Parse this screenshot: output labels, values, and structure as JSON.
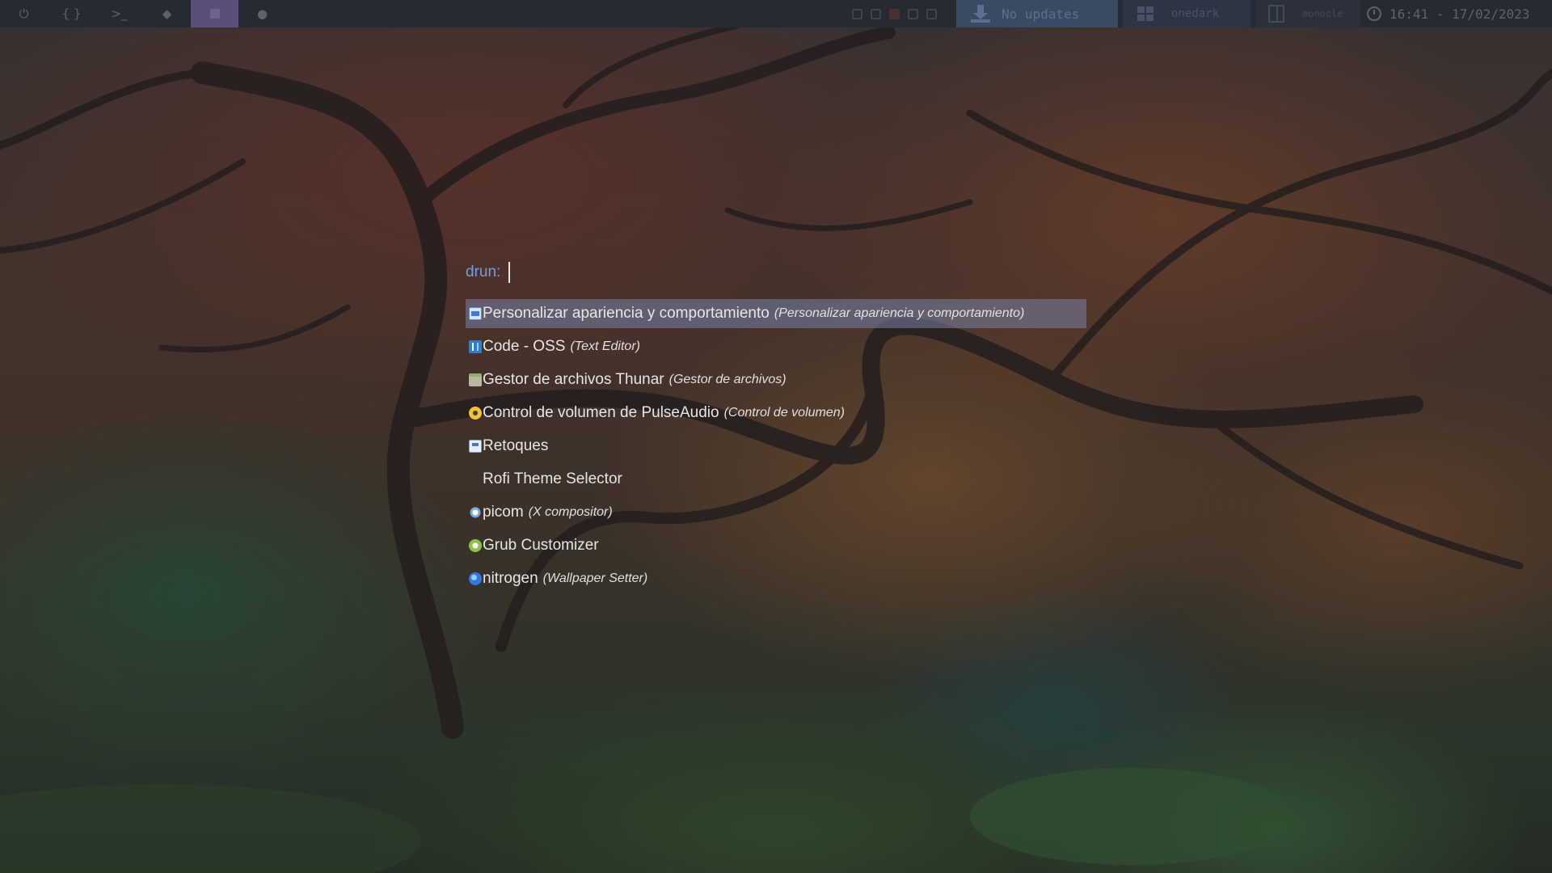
{
  "colors": {
    "bar_bg": "#262a32",
    "active_workspace": "#5a4f78",
    "updates_bg": "#3a4a63",
    "prompt": "#6f9fe0",
    "selection": "#6a7396"
  },
  "topbar": {
    "workspaces": [
      {
        "icon": "power-icon",
        "glyph": "⏻"
      },
      {
        "icon": "braces-icon",
        "glyph": "{}"
      },
      {
        "icon": "terminal-icon",
        "glyph": ">_"
      },
      {
        "icon": "layers-icon",
        "glyph": "◆"
      },
      {
        "icon": "active-workspace-icon",
        "glyph": ""
      },
      {
        "icon": "record-icon",
        "glyph": "●"
      }
    ],
    "updates_text": "No updates",
    "theme_text": "onedark",
    "layout_text": "monocle",
    "clock_text": "16:41 - 17/02/2023"
  },
  "launcher": {
    "prompt": "drun:",
    "items": [
      {
        "name": "Personalizar apariencia y comportamiento",
        "desc": "(Personalizar apariencia y comportamiento)",
        "icon": "window-icon"
      },
      {
        "name": "Code - OSS",
        "desc": "(Text Editor)",
        "icon": "code-icon"
      },
      {
        "name": "Gestor de archivos Thunar",
        "desc": "(Gestor de archivos)",
        "icon": "folder-icon"
      },
      {
        "name": "Control de volumen de PulseAudio",
        "desc": "(Control de volumen)",
        "icon": "volume-icon"
      },
      {
        "name": "Retoques",
        "desc": "",
        "icon": "tweaks-icon"
      },
      {
        "name": "Rofi Theme Selector",
        "desc": "",
        "icon": "blank"
      },
      {
        "name": "picom",
        "desc": "(X compositor)",
        "icon": "picom-icon"
      },
      {
        "name": "Grub Customizer",
        "desc": "",
        "icon": "grub-icon"
      },
      {
        "name": "nitrogen",
        "desc": "(Wallpaper Setter)",
        "icon": "nitrogen-icon"
      }
    ]
  }
}
